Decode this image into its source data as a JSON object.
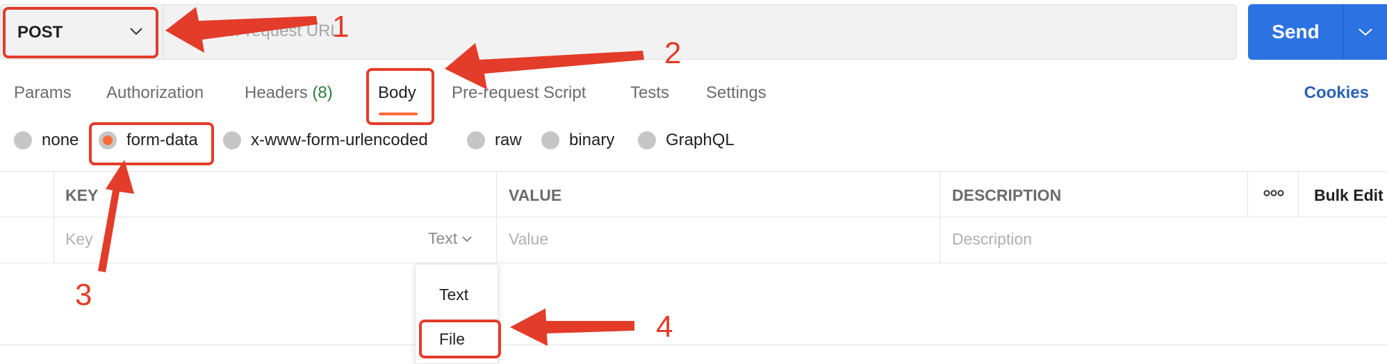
{
  "request": {
    "method": "POST",
    "url_placeholder": "Enter request URL",
    "send_label": "Send"
  },
  "tabs": [
    {
      "label": "Params"
    },
    {
      "label": "Authorization"
    },
    {
      "label": "Headers",
      "count": "(8)"
    },
    {
      "label": "Body",
      "active": true
    },
    {
      "label": "Pre-request Script"
    },
    {
      "label": "Tests"
    },
    {
      "label": "Settings"
    }
  ],
  "cookies_label": "Cookies",
  "body_types": [
    {
      "label": "none"
    },
    {
      "label": "form-data",
      "selected": true
    },
    {
      "label": "x-www-form-urlencoded"
    },
    {
      "label": "raw"
    },
    {
      "label": "binary"
    },
    {
      "label": "GraphQL"
    }
  ],
  "table": {
    "headers": {
      "key": "KEY",
      "value": "VALUE",
      "description": "DESCRIPTION",
      "bulk_edit": "Bulk Edit"
    },
    "row": {
      "key_placeholder": "Key",
      "type_value": "Text",
      "value_placeholder": "Value",
      "description_placeholder": "Description"
    }
  },
  "type_menu": {
    "options": [
      "Text",
      "File"
    ]
  },
  "annotations": {
    "labels": [
      "1",
      "2",
      "3",
      "4"
    ]
  },
  "colors": {
    "accent": "#ff6c37",
    "send": "#2d72e3",
    "link": "#2a61b8",
    "headers_count": "#2b7a3d",
    "annotation": "#e33c2a"
  }
}
